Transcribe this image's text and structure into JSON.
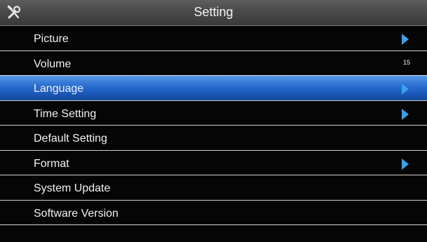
{
  "header": {
    "title": "Setting",
    "icon": "tools-icon"
  },
  "menu": {
    "items": [
      {
        "label": "Picture",
        "has_submenu": true
      },
      {
        "label": "Volume",
        "value": "15"
      },
      {
        "label": "Language",
        "has_submenu": true,
        "selected": true
      },
      {
        "label": "Time Setting",
        "has_submenu": true
      },
      {
        "label": "Default Setting"
      },
      {
        "label": "Format",
        "has_submenu": true
      },
      {
        "label": "System Update"
      },
      {
        "label": "Software Version"
      }
    ]
  },
  "colors": {
    "selection": "#1e5dc0",
    "arrow": "#3aa0ea",
    "background": "#050505",
    "titlebar": "#4a4a4a"
  }
}
